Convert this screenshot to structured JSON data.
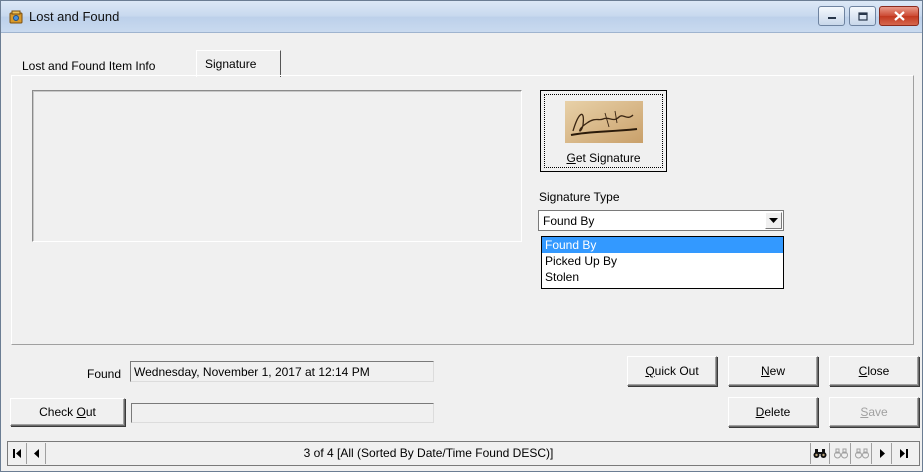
{
  "window": {
    "title": "Lost and Found"
  },
  "tabs": [
    {
      "label": "Lost and Found Item Info",
      "active": false
    },
    {
      "label": "Signature",
      "active": true
    }
  ],
  "signature": {
    "get_signature_label_mnemonic": "G",
    "get_signature_label_rest": "et Signature",
    "type_label": "Signature Type",
    "type_value": "Found By",
    "type_options": [
      "Found By",
      "Picked Up By",
      "Stolen"
    ],
    "highlighted_option": "Found By"
  },
  "found": {
    "label": "Found",
    "value": "Wednesday, November 1, 2017 at 12:14 PM"
  },
  "checkout": {
    "label_pre": "Check ",
    "label_mnemonic": "O",
    "label_rest": "ut",
    "value": ""
  },
  "buttons": {
    "quick_out_mnemonic": "Q",
    "quick_out_rest": "uick Out",
    "new_mnemonic": "N",
    "new_rest": "ew",
    "close_mnemonic": "C",
    "close_rest": "lose",
    "delete_mnemonic": "D",
    "delete_rest": "elete",
    "save_mnemonic": "S",
    "save_rest": "ave",
    "save_enabled": false
  },
  "navigation": {
    "status": "3 of 4 [All (Sorted By Date/Time Found DESC)]",
    "icons": [
      "first-record-icon",
      "previous-record-icon",
      "find-icon",
      "find-next-icon",
      "find-previous-icon",
      "next-record-icon",
      "last-record-icon"
    ]
  },
  "colors": {
    "selection": "#3399ff",
    "close_button": "#c2381f"
  }
}
